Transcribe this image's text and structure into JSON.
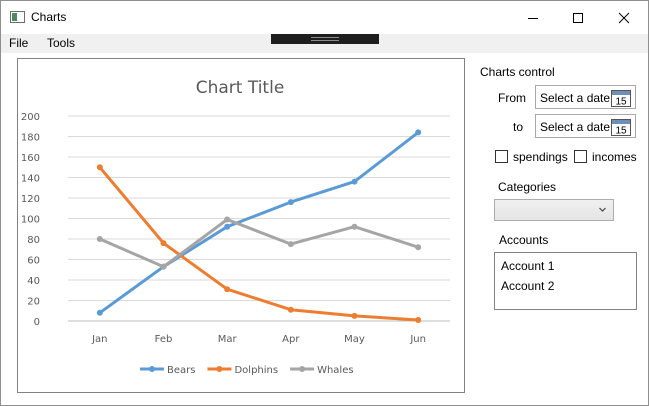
{
  "window": {
    "title": "Charts"
  },
  "menu": {
    "file": "File",
    "tools": "Tools"
  },
  "controls": {
    "panel_title": "Charts control",
    "from_label": "From",
    "to_label": "to",
    "from_placeholder": "Select a date",
    "to_placeholder": "Select a date",
    "calendar_day": "15",
    "spendings_label": "spendings",
    "incomes_label": "incomes",
    "categories_label": "Categories",
    "accounts_label": "Accounts",
    "accounts": [
      "Account 1",
      "Account 2"
    ]
  },
  "chart_data": {
    "type": "line",
    "title": "Chart Title",
    "categories": [
      "Jan",
      "Feb",
      "Mar",
      "Apr",
      "May",
      "Jun"
    ],
    "ylim": [
      0,
      200
    ],
    "yticks": [
      0,
      20,
      40,
      60,
      80,
      100,
      120,
      140,
      160,
      180,
      200
    ],
    "grid": true,
    "legend": "bottom",
    "series": [
      {
        "name": "Bears",
        "color": "#5b9bd5",
        "values": [
          8,
          53,
          92,
          116,
          136,
          184
        ]
      },
      {
        "name": "Dolphins",
        "color": "#ed7d31",
        "values": [
          150,
          76,
          31,
          11,
          5,
          1
        ]
      },
      {
        "name": "Whales",
        "color": "#a5a5a5",
        "values": [
          80,
          53,
          99,
          75,
          92,
          72
        ]
      }
    ]
  }
}
